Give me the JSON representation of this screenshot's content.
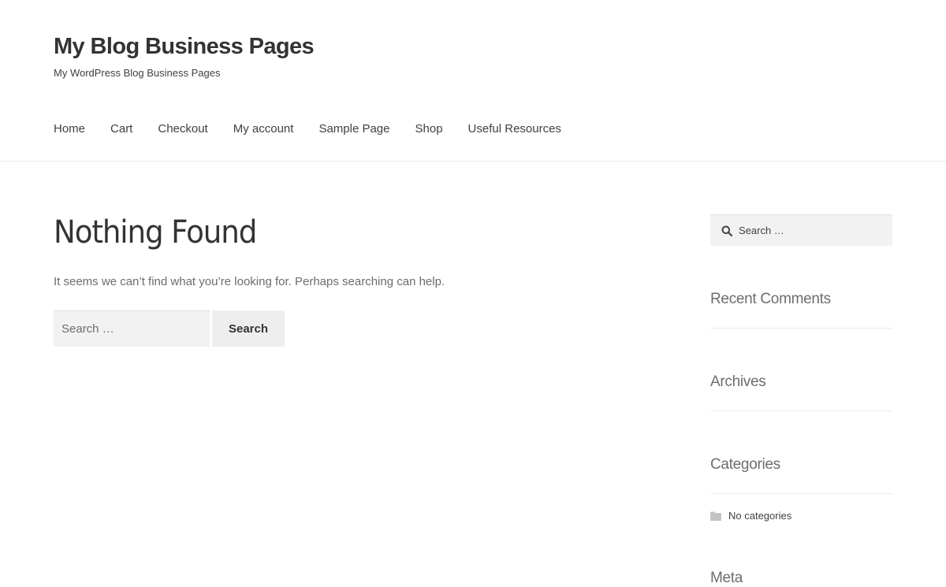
{
  "header": {
    "site_title": "My Blog Business Pages",
    "tagline": "My WordPress Blog Business Pages"
  },
  "nav": {
    "items": [
      {
        "label": "Home"
      },
      {
        "label": "Cart"
      },
      {
        "label": "Checkout"
      },
      {
        "label": "My account"
      },
      {
        "label": "Sample Page"
      },
      {
        "label": "Shop"
      },
      {
        "label": "Useful Resources"
      }
    ]
  },
  "main": {
    "title": "Nothing Found",
    "message": "It seems we can’t find what you’re looking for. Perhaps searching can help.",
    "search": {
      "placeholder": "Search …",
      "value": "",
      "button_label": "Search"
    }
  },
  "sidebar": {
    "search": {
      "placeholder": "Search …",
      "value": ""
    },
    "widgets": {
      "recent_comments": {
        "title": "Recent Comments"
      },
      "archives": {
        "title": "Archives"
      },
      "categories": {
        "title": "Categories",
        "empty_text": "No categories"
      },
      "meta": {
        "title": "Meta"
      }
    }
  },
  "icons": {
    "sidebar_search": "search-icon",
    "category_folder": "folder-icon"
  },
  "colors": {
    "title": "#333333",
    "body_text": "#6d6d6d",
    "input_bg": "#f2f2f2",
    "button_bg": "#eeeeee",
    "divider": "#e8e8e8"
  }
}
